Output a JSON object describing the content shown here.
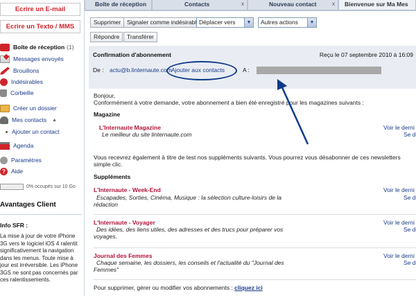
{
  "sidebar": {
    "email_button": "Ecrire un E-mail",
    "sms_button": "Ecrire un Texto / MMS",
    "items": [
      {
        "label": "Boîte de réception",
        "count": "(1)",
        "icon": "inbox-icon"
      },
      {
        "label": "Messages envoyés",
        "icon": "sent-icon"
      },
      {
        "label": "Brouillons",
        "icon": "drafts-icon"
      },
      {
        "label": "Indésirables",
        "icon": "spam-icon"
      },
      {
        "label": "Corbeille",
        "icon": "trash-icon"
      },
      {
        "label": "Créer un dossier",
        "icon": "folder-icon"
      },
      {
        "label": "Mes contacts",
        "icon": "contacts-icon"
      },
      {
        "label": "Ajouter un contact"
      },
      {
        "label": "Agenda",
        "icon": "agenda-icon"
      },
      {
        "label": "Paramètres",
        "icon": "settings-icon"
      },
      {
        "label": "Aide",
        "icon": "help-icon"
      }
    ],
    "quota": "0% occupés sur 10 Go",
    "advantages_title": "Avantages Client",
    "info_title": "Info SFR :",
    "info_text": "La mise à jour de votre iPhone 3G vers le logiciel iOS 4 ralentit significativement la navigation dans les menus. Toute mise à jour est irréversible. Les iPhone 3GS ne sont pas concernés par ces ralentissements."
  },
  "tabs": [
    {
      "label": "Boîte de réception"
    },
    {
      "label": "Contacts"
    },
    {
      "label": "Nouveau contact"
    },
    {
      "label": "Bienvenue sur Ma Mes"
    }
  ],
  "toolbar": {
    "delete": "Supprimer",
    "report_spam": "Signaler comme indésirable",
    "move_to": "Déplacer vers",
    "other_actions": "Autres actions",
    "reply": "Répondre",
    "forward": "Transférer"
  },
  "message": {
    "subject": "Confirmation d'abonnement",
    "received": "Reçu le 07 septembre 2010 à 16:09",
    "from_label": "De :",
    "from_addr": "actu@b.linternaute.com",
    "add_contact": "Ajouter aux contacts",
    "to_label": "A :"
  },
  "body": {
    "greeting": "Bonjour,",
    "intro": "Conformément à votre demande, votre abonnement a bien été enregistré pour les magazines suivants :",
    "magazine_title": "Magazine",
    "magazine_name": "L'Internaute Magazine",
    "magazine_desc": "Le meilleur du site linternaute.com",
    "voir_label": "Voir le derni",
    "desab_label": "Se dé",
    "test_text_line1": "Vous recevrez également à titre de test nos suppléments suivants. Vous pourrez vous désabonner de ces newsletters",
    "test_text_line2": "simple clic.",
    "supplements_title": "Suppléments",
    "supplements": [
      {
        "name": "L'Internaute - Week-End",
        "desc_lines": [
          "Escapades, Sorties, Cinéma, Musique : la sélection culture-loisirs de la",
          "rédaction"
        ]
      },
      {
        "name": "L'Internaute - Voyager",
        "desc_lines": [
          "Des idées, des liens utiles, des adresses et des trucs pour préparer vos",
          "voyages."
        ]
      },
      {
        "name": "Journal des Femmes",
        "desc_lines": [
          "Chaque semaine, les dossiers, les conseils et l'actualité du \"Journal des",
          "Femmes\""
        ]
      }
    ],
    "manage_text": "Pour supprimer, gérer ou modifier vos abonnements :",
    "manage_link": "cliquez ici"
  }
}
